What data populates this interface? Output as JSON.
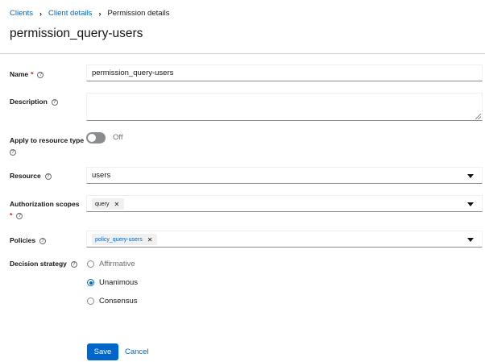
{
  "breadcrumb": {
    "items": [
      "Clients",
      "Client details",
      "Permission details"
    ]
  },
  "page": {
    "title": "permission_query-users"
  },
  "form": {
    "name": {
      "label": "Name",
      "required": "*",
      "value": "permission_query-users"
    },
    "description": {
      "label": "Description",
      "value": ""
    },
    "apply_resource_type": {
      "label": "Apply to resource type",
      "state": "Off",
      "on": false
    },
    "resource": {
      "label": "Resource",
      "value": "users"
    },
    "authorization_scopes": {
      "label": "Authorization scopes",
      "required": "*",
      "chips": [
        "query"
      ]
    },
    "policies": {
      "label": "Policies",
      "chips": [
        "policy_query-users"
      ]
    },
    "decision_strategy": {
      "label": "Decision strategy",
      "options": [
        "Affirmative",
        "Unanimous",
        "Consensus"
      ],
      "selected": "Unanimous"
    }
  },
  "actions": {
    "save": "Save",
    "cancel": "Cancel"
  },
  "colors": {
    "accent": "#0066cc",
    "required": "#c9190b",
    "toggle_off": "#8a8d90"
  },
  "icons": {
    "help": "help-circle-icon",
    "separator": "chevron-right-icon",
    "caret": "caret-down-icon",
    "remove": "close-icon"
  }
}
